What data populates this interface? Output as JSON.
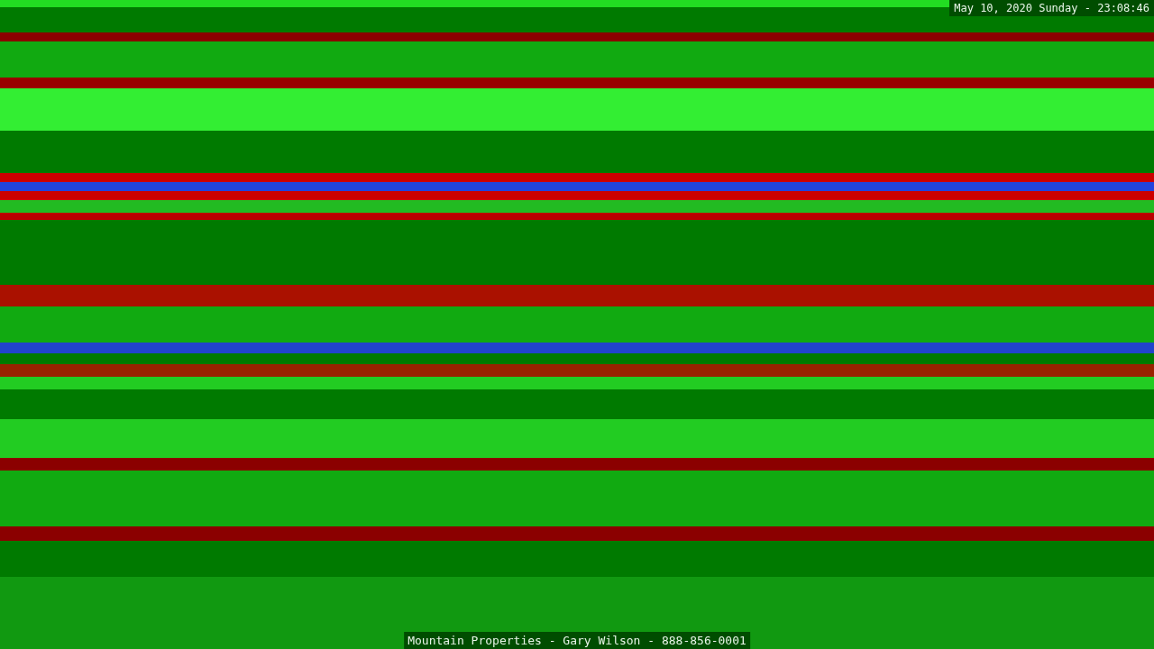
{
  "clock": {
    "text": "May 10, 2020 Sunday - 23:08:46"
  },
  "caption": {
    "text": "Mountain Properties - Gary Wilson - 888-856-0001"
  }
}
